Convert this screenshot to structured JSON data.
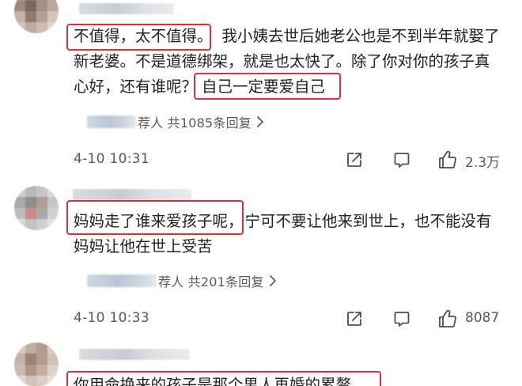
{
  "comments": [
    {
      "segments": [
        "不值得，太不值得。",
        "我小姨去世后她老公也是不到半年就娶了",
        "新老婆。不是道德绑架，就是也太快了。除了你对你的孩子真",
        "心好，还有谁呢？",
        "自己一定要爱自己"
      ],
      "reply_text": "荐人 共1085条回复",
      "time": "4-10 10:31",
      "likes": "2.3万"
    },
    {
      "segments": [
        "妈妈走了谁来爱孩子呢，",
        "宁可不要让他来到世上，也不能没有",
        "妈妈让他在世上受苦"
      ],
      "reply_text": "荐人 共201条回复",
      "time": "4-10 10:33",
      "likes": "8087"
    },
    {
      "segments": [
        "你用命换来的孩子是那个男人再婚的累赘"
      ]
    }
  ],
  "colors": {
    "highlight": "#d9323a",
    "text": "#222222",
    "meta": "#555a60"
  },
  "icons": {
    "reply_chevron": "chevron-right-icon",
    "share": "share-icon",
    "comment": "comment-icon",
    "like": "thumbs-up-icon"
  }
}
